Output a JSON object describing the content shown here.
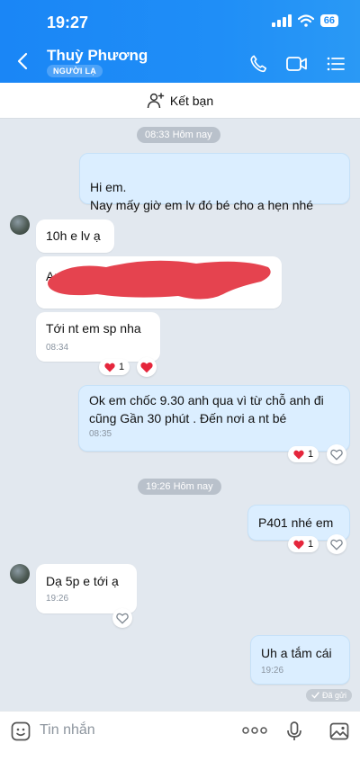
{
  "status_bar": {
    "time": "19:27",
    "battery": "66"
  },
  "header": {
    "contact_name": "Thuỳ Phương",
    "stranger_badge": "NGƯỜI LẠ"
  },
  "friend_bar": {
    "label": "Kết bạn"
  },
  "timestamps": {
    "first": "08:33 Hôm nay",
    "second": "19:26 Hôm nay"
  },
  "messages": {
    "m1": {
      "text": "Hi em.\nNay mấy giờ em lv đó bé cho a hẹn nhé"
    },
    "m2": {
      "text": "10h e lv ạ"
    },
    "m3": {
      "text": "Anh ch"
    },
    "m4": {
      "text": "Tới nt em sp nha",
      "time": "08:34",
      "reaction_count": "1"
    },
    "m5": {
      "text": "Ok em chốc 9.30 anh qua vì từ chỗ anh đi cũng Gần 30 phút . Đến nơi a nt bé",
      "time": "08:35",
      "reaction_count": "1"
    },
    "m6": {
      "text": "P401 nhé em",
      "reaction_count": "1"
    },
    "m7": {
      "text": "Dạ 5p e tới ạ",
      "time": "19:26"
    },
    "m8": {
      "text": "Uh a tắm cái",
      "time": "19:26",
      "status": "Đã gửi"
    }
  },
  "input": {
    "placeholder": "Tin nhắn"
  },
  "colors": {
    "header": "#1f8ef7",
    "outgoing_bubble": "#dbeeff",
    "chat_background": "#e2e8ef",
    "heart": "#e5263c",
    "redaction": "#e5434f"
  }
}
